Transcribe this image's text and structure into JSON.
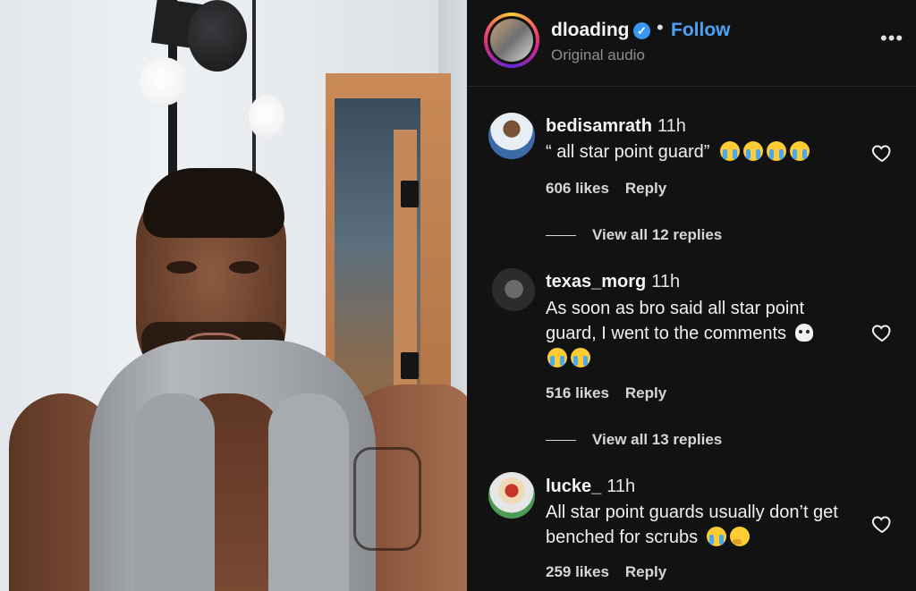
{
  "post": {
    "username": "dloading",
    "verified_mark": "✓",
    "separator": "•",
    "follow_label": "Follow",
    "audio_label": "Original audio",
    "more_label": "•••"
  },
  "comments": [
    {
      "user": "bedisamrath",
      "time": "11h",
      "text": "“ all star point guard”",
      "emoji": [
        "loudly-crying-face",
        "loudly-crying-face",
        "loudly-crying-face",
        "loudly-crying-face"
      ],
      "likes": "606 likes",
      "reply_label": "Reply",
      "view_replies": "View all 12 replies"
    },
    {
      "user": "texas_morg",
      "time": "11h",
      "text": "As soon as bro said all star point guard, I went to the comments",
      "emoji": [
        "skull",
        "loudly-crying-face",
        "loudly-crying-face"
      ],
      "likes": "516 likes",
      "reply_label": "Reply",
      "view_replies": "View all 13 replies"
    },
    {
      "user": "lucke_",
      "time": "11h",
      "text": "All star point guards usually don’t get benched for scrubs",
      "emoji": [
        "loudly-crying-face",
        "thinking-face"
      ],
      "likes": "259 likes",
      "reply_label": "Reply"
    }
  ],
  "colors": {
    "panel_bg": "#121212",
    "follow_blue": "#4aa3f5",
    "verified_blue": "#3897f0"
  }
}
